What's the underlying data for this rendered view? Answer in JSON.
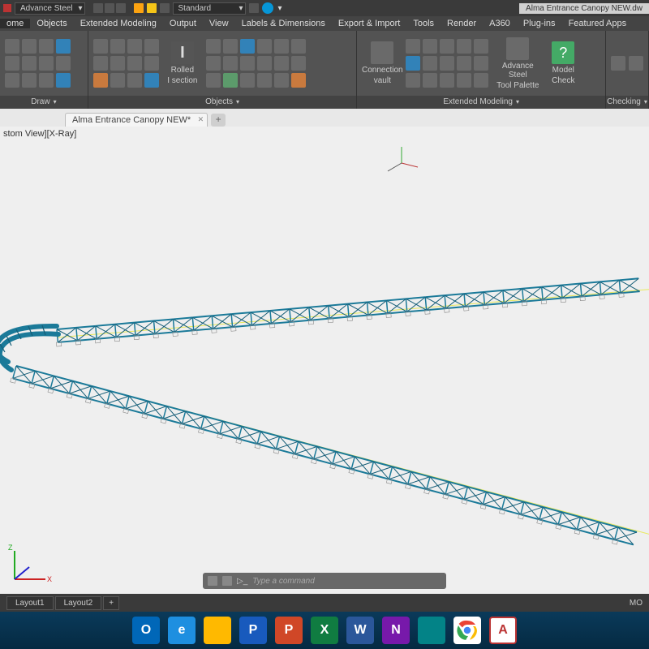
{
  "titlebar": {
    "app_dropdown": "Advance Steel",
    "style_dropdown": "Standard",
    "doc_title": "Alma Entrance Canopy NEW.dw"
  },
  "menubar": {
    "items": [
      "ome",
      "Objects",
      "Extended Modeling",
      "Output",
      "View",
      "Labels & Dimensions",
      "Export & Import",
      "Tools",
      "Render",
      "A360",
      "Plug-ins",
      "Featured Apps"
    ]
  },
  "ribbon": {
    "panels": [
      {
        "label": "Draw"
      },
      {
        "label": "Objects",
        "big": {
          "line1": "Rolled",
          "line2": "I section"
        }
      },
      {
        "label": "Extended Modeling",
        "big1": {
          "line1": "Connection",
          "line2": "vault"
        },
        "big2": {
          "line1": "Advance Steel",
          "line2": "Tool Palette"
        },
        "big3": {
          "line1": "Model",
          "line2": "Check"
        }
      },
      {
        "label": "Checking"
      }
    ]
  },
  "doctab": {
    "name": "Alma Entrance Canopy NEW*"
  },
  "viewport": {
    "label": "stom View][X-Ray]",
    "cmd_placeholder": "Type a command"
  },
  "bottom": {
    "tabs": [
      "Layout1",
      "Layout2"
    ],
    "status": "MO"
  },
  "taskbar": {
    "apps": [
      {
        "bg": "#0067b8",
        "txt": "O"
      },
      {
        "bg": "#1e8fe0",
        "txt": "e"
      },
      {
        "bg": "#ffb900",
        "txt": ""
      },
      {
        "bg": "#185abd",
        "txt": "P"
      },
      {
        "bg": "#d04727",
        "txt": "P"
      },
      {
        "bg": "#107c41",
        "txt": "X"
      },
      {
        "bg": "#2b579a",
        "txt": "W"
      },
      {
        "bg": "#7719aa",
        "txt": "N"
      },
      {
        "bg": "#038387",
        "txt": ""
      },
      {
        "bg": "#ffffff",
        "txt": ""
      },
      {
        "bg": "#d54b3d",
        "txt": "A"
      }
    ]
  }
}
